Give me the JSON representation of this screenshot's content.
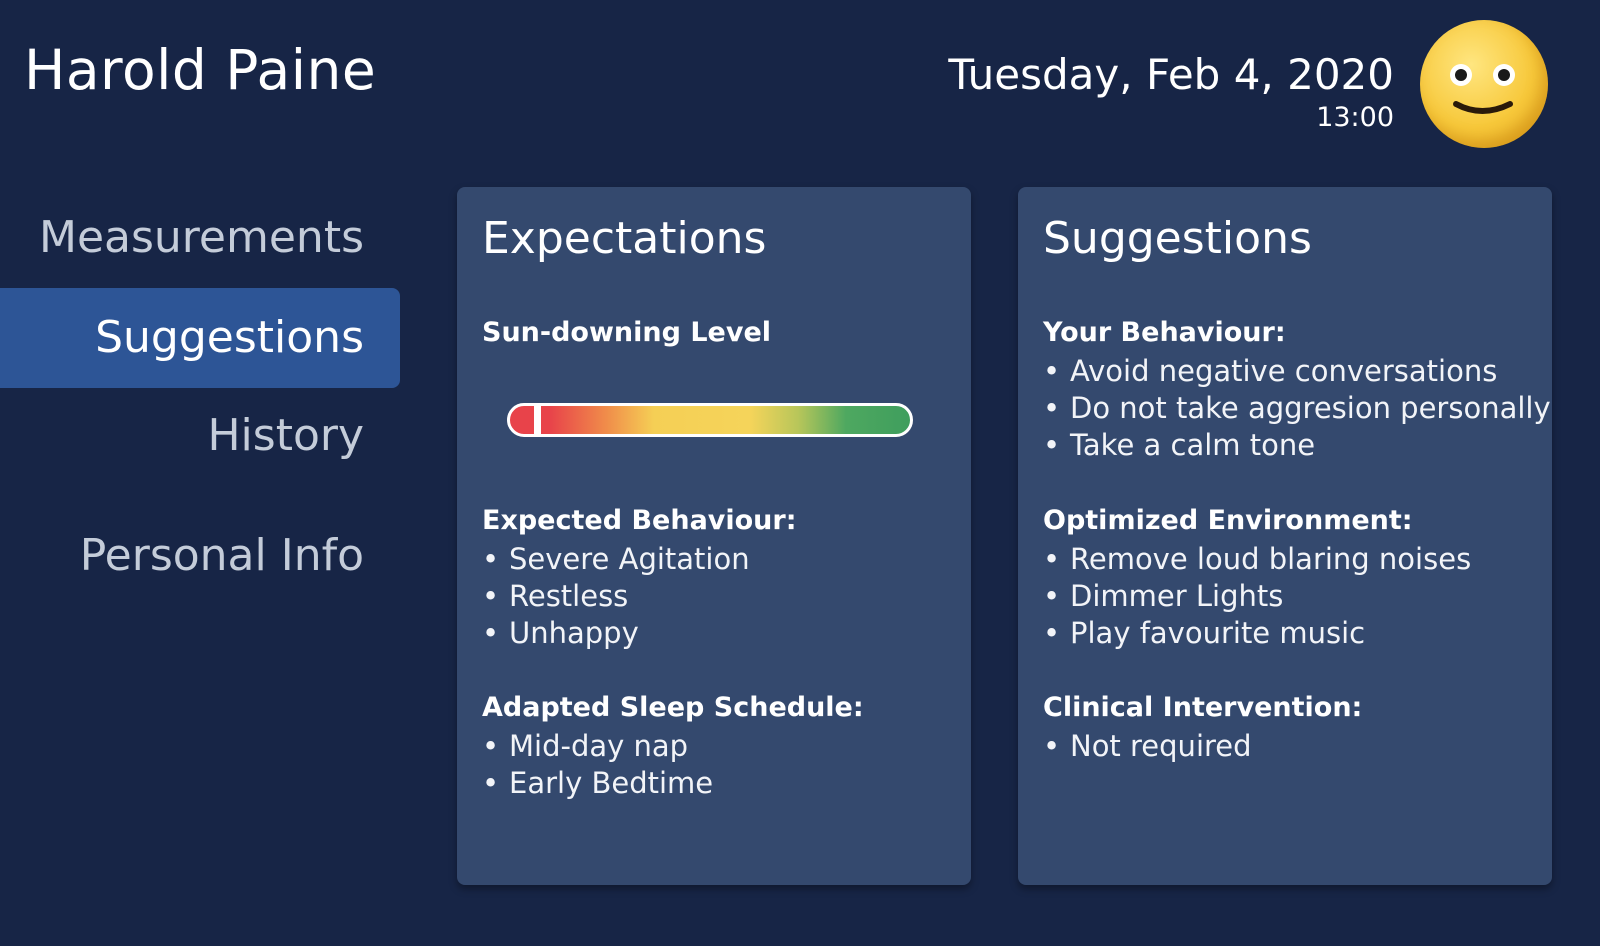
{
  "header": {
    "patient_name": "Harold Paine",
    "date": "Tuesday, Feb 4, 2020",
    "time": "13:00",
    "avatar_icon": "smiley-face-icon"
  },
  "nav": {
    "items": [
      {
        "label": "Measurements",
        "active": false
      },
      {
        "label": "Suggestions",
        "active": true
      },
      {
        "label": "History",
        "active": false
      },
      {
        "label": "Personal Info",
        "active": false
      }
    ]
  },
  "expectations": {
    "title": "Expectations",
    "sundowning": {
      "label": "Sun-downing Level",
      "level_fraction": 0.06
    },
    "expected_behaviour": {
      "label": "Expected Behaviour:",
      "items": [
        "Severe Agitation",
        "Restless",
        "Unhappy"
      ]
    },
    "sleep_schedule": {
      "label": "Adapted Sleep Schedule:",
      "items": [
        "Mid-day nap",
        "Early Bedtime"
      ]
    }
  },
  "suggestions": {
    "title": "Suggestions",
    "your_behaviour": {
      "label": "Your Behaviour:",
      "items": [
        "Avoid negative conversations",
        "Do not take aggresion personally",
        "Take a calm tone"
      ]
    },
    "environment": {
      "label": "Optimized Environment:",
      "items": [
        "Remove loud blaring noises",
        "Dimmer Lights",
        "Play favourite music"
      ]
    },
    "clinical": {
      "label": "Clinical Intervention:",
      "items": [
        "Not required"
      ]
    }
  },
  "colors": {
    "background": "#172546",
    "card": "#34496e",
    "nav_active": "#2d5596"
  }
}
